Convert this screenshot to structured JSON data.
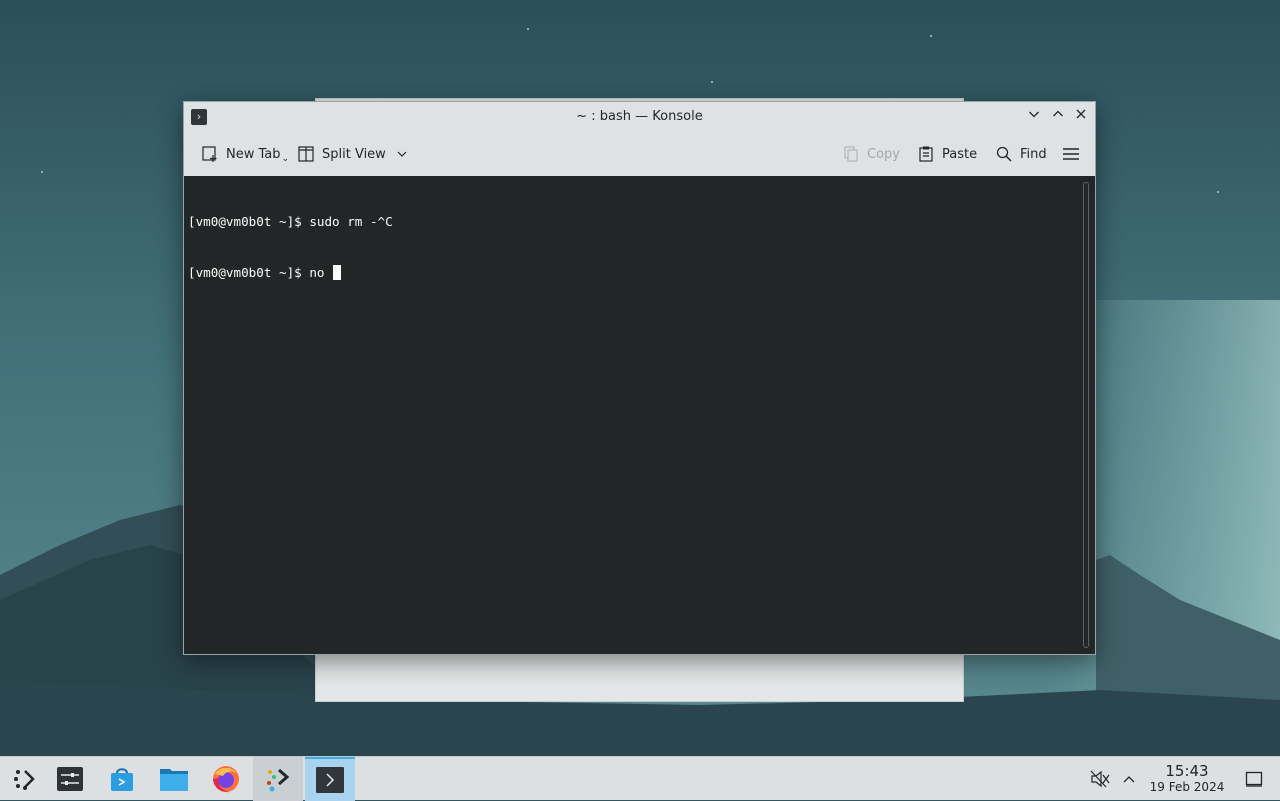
{
  "window": {
    "title": "~ : bash — Konsole",
    "controls": {
      "minimize": "⌄",
      "maximize": "⌃",
      "close": "✕"
    }
  },
  "toolbar": {
    "new_tab": "New Tab",
    "split_view": "Split View",
    "copy": "Copy",
    "paste": "Paste",
    "find": "Find"
  },
  "terminal": {
    "lines": [
      "[vm0@vm0b0t ~]$ sudo rm -^C",
      "[vm0@vm0b0t ~]$ no "
    ]
  },
  "taskbar": {
    "apps": [
      {
        "name": "application-launcher",
        "icon": "kde-launcher-icon"
      },
      {
        "name": "system-settings",
        "icon": "settings-sliders-icon"
      },
      {
        "name": "discover",
        "icon": "shopping-bag-icon"
      },
      {
        "name": "dolphin",
        "icon": "folder-icon"
      },
      {
        "name": "firefox",
        "icon": "firefox-icon"
      },
      {
        "name": "kde-connect",
        "icon": "kde-connect-icon"
      },
      {
        "name": "konsole",
        "icon": "terminal-icon"
      }
    ],
    "clock": {
      "time": "15:43",
      "date": "19 Feb 2024"
    }
  },
  "colors": {
    "accent": "#3daee9",
    "terminal_bg": "#232627",
    "terminal_fg": "#fcfcfc",
    "panel_bg": "#dde0e2"
  }
}
